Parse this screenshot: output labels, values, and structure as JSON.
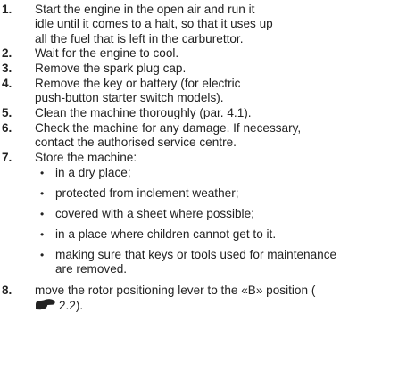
{
  "steps": [
    {
      "num": "1.",
      "lines": [
        "Start the engine in the open air and run it",
        "idle until it comes to a halt, so that it uses up",
        "all the fuel that is left in the carburettor."
      ]
    },
    {
      "num": "2.",
      "lines": [
        "Wait for the engine to cool."
      ]
    },
    {
      "num": "3.",
      "lines": [
        "Remove the spark plug cap."
      ]
    },
    {
      "num": "4.",
      "lines": [
        "Remove the key or battery (for electric",
        "push-button starter switch models)."
      ]
    },
    {
      "num": "5.",
      "lines": [
        "Clean the machine thoroughly (par. 4.1)."
      ]
    },
    {
      "num": "6.",
      "lines": [
        "Check the machine for any damage. If necessary,",
        "contact the authorised service centre."
      ]
    },
    {
      "num": "7.",
      "lines": [
        "Store the machine:"
      ]
    },
    {
      "num": "8.",
      "lines": [
        "move the rotor positioning lever to the «B» position ("
      ],
      "ref": "2.2)."
    }
  ],
  "storage_bullets": [
    {
      "lines": [
        "in a dry place;"
      ]
    },
    {
      "lines": [
        "protected from inclement weather;"
      ]
    },
    {
      "lines": [
        "covered with a sheet where possible;"
      ]
    },
    {
      "lines": [
        "in a place where children cannot get to it."
      ]
    },
    {
      "lines": [
        "making sure that keys or tools used for maintenance",
        "are removed."
      ]
    }
  ],
  "bullet_glyph": "•",
  "reference_icon": "pointing-hand-icon"
}
